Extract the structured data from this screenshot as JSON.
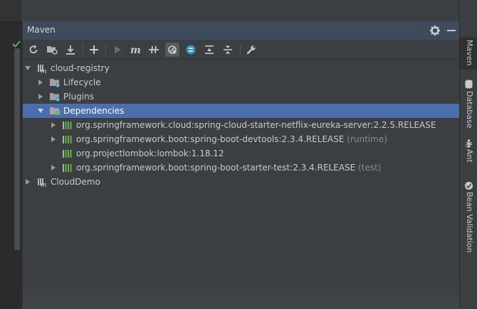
{
  "panel": {
    "title": "Maven",
    "settings_icon": "gear-icon",
    "minimize_icon": "minimize-icon"
  },
  "toolbar": {
    "buttons": [
      {
        "name": "reload-all-projects",
        "icon": "refresh-icon"
      },
      {
        "name": "generate-sources",
        "icon": "folder-refresh-icon"
      },
      {
        "name": "download-sources",
        "icon": "download-icon"
      },
      {
        "name": "add-maven-project",
        "icon": "plus-icon"
      },
      {
        "name": "run-maven-build",
        "icon": "play-icon"
      },
      {
        "name": "execute-maven-goal",
        "icon": "maven-m-icon"
      },
      {
        "name": "toggle-offline-mode",
        "icon": "offline-icon"
      },
      {
        "name": "skip-tests",
        "icon": "skip-tests-icon"
      },
      {
        "name": "show-dependencies",
        "icon": "diagram-icon"
      },
      {
        "name": "expand-all",
        "icon": "expand-all-icon"
      },
      {
        "name": "collapse-all",
        "icon": "collapse-all-icon"
      },
      {
        "name": "maven-settings",
        "icon": "wrench-icon"
      }
    ]
  },
  "tree": [
    {
      "label": "cloud-registry",
      "suffix": "",
      "expanded": true,
      "icon": "maven-module-icon"
    },
    {
      "label": "Lifecycle",
      "suffix": "",
      "expanded": false,
      "icon": "folder-gear-icon"
    },
    {
      "label": "Plugins",
      "suffix": "",
      "expanded": false,
      "icon": "folder-gear-icon"
    },
    {
      "label": "Dependencies",
      "suffix": "",
      "expanded": true,
      "icon": "folder-library-icon",
      "selected": true
    },
    {
      "label": "org.springframework.cloud:spring-cloud-starter-netflix-eureka-server:2.2.5.RELEASE",
      "suffix": "",
      "expanded": false,
      "icon": "library-icon"
    },
    {
      "label": "org.springframework.boot:spring-boot-devtools:2.3.4.RELEASE",
      "suffix": "(runtime)",
      "expanded": false,
      "icon": "library-icon"
    },
    {
      "label": "org.projectlombok:lombok:1.18.12",
      "suffix": "",
      "icon": "library-icon"
    },
    {
      "label": "org.springframework.boot:spring-boot-starter-test:2.3.4.RELEASE",
      "suffix": "(test)",
      "expanded": false,
      "icon": "library-icon"
    },
    {
      "label": "CloudDemo",
      "suffix": "",
      "expanded": false,
      "icon": "maven-module-icon"
    }
  ],
  "side_tabs": [
    {
      "label": "Maven",
      "icon": "maven-m-icon",
      "active": true
    },
    {
      "label": "Database",
      "icon": "database-icon"
    },
    {
      "label": "Ant",
      "icon": "ant-icon"
    },
    {
      "label": "Bean Validation",
      "icon": "bean-validation-icon"
    }
  ],
  "colors": {
    "selection": "#4b6eaf",
    "header": "#3d4b5c",
    "panel_bg": "#3c3f41",
    "library_green": "#62b543"
  }
}
